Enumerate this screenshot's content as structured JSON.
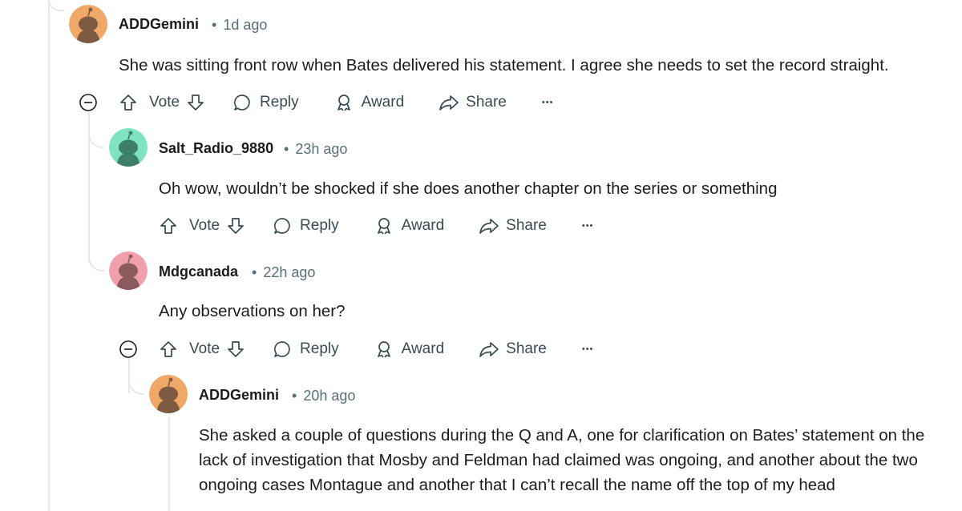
{
  "comments": [
    {
      "username": "ADDGemini",
      "time": "1d ago",
      "text": "She was sitting front row when Bates delivered his statement. I agree she needs to set the record straight.",
      "avatar_color": "#f0a868",
      "avatar_body_color": "#7d5a42"
    },
    {
      "username": "Salt_Radio_9880",
      "time": "23h ago",
      "text": "Oh wow, wouldn’t be shocked if she does another chapter on the series or something",
      "avatar_color": "#7fe3c3",
      "avatar_body_color": "#3e7f6c"
    },
    {
      "username": "Mdgcanada",
      "time": "22h ago",
      "text": "Any observations on her?",
      "avatar_color": "#f0a0ab",
      "avatar_body_color": "#8a5a5f"
    },
    {
      "username": "ADDGemini",
      "time": "20h ago",
      "text": "She asked a couple of questions during the Q and A, one for clarification on Bates’ statement on the lack of investigation that Mosby and Feldman had claimed was ongoing, and another about the two ongoing cases Montague and another that I can’t recall the name off the top of my head",
      "avatar_color": "#f0a868",
      "avatar_body_color": "#7d5a42"
    }
  ],
  "actions": {
    "vote": "Vote",
    "reply": "Reply",
    "award": "Award",
    "share": "Share",
    "more": "•••"
  },
  "separator": "•",
  "icons": {
    "upvote": "arrow-up-icon",
    "downvote": "arrow-down-icon",
    "reply": "speech-bubble-icon",
    "award": "award-ribbon-icon",
    "share": "share-arrow-icon",
    "collapse": "minus-circle-icon"
  }
}
